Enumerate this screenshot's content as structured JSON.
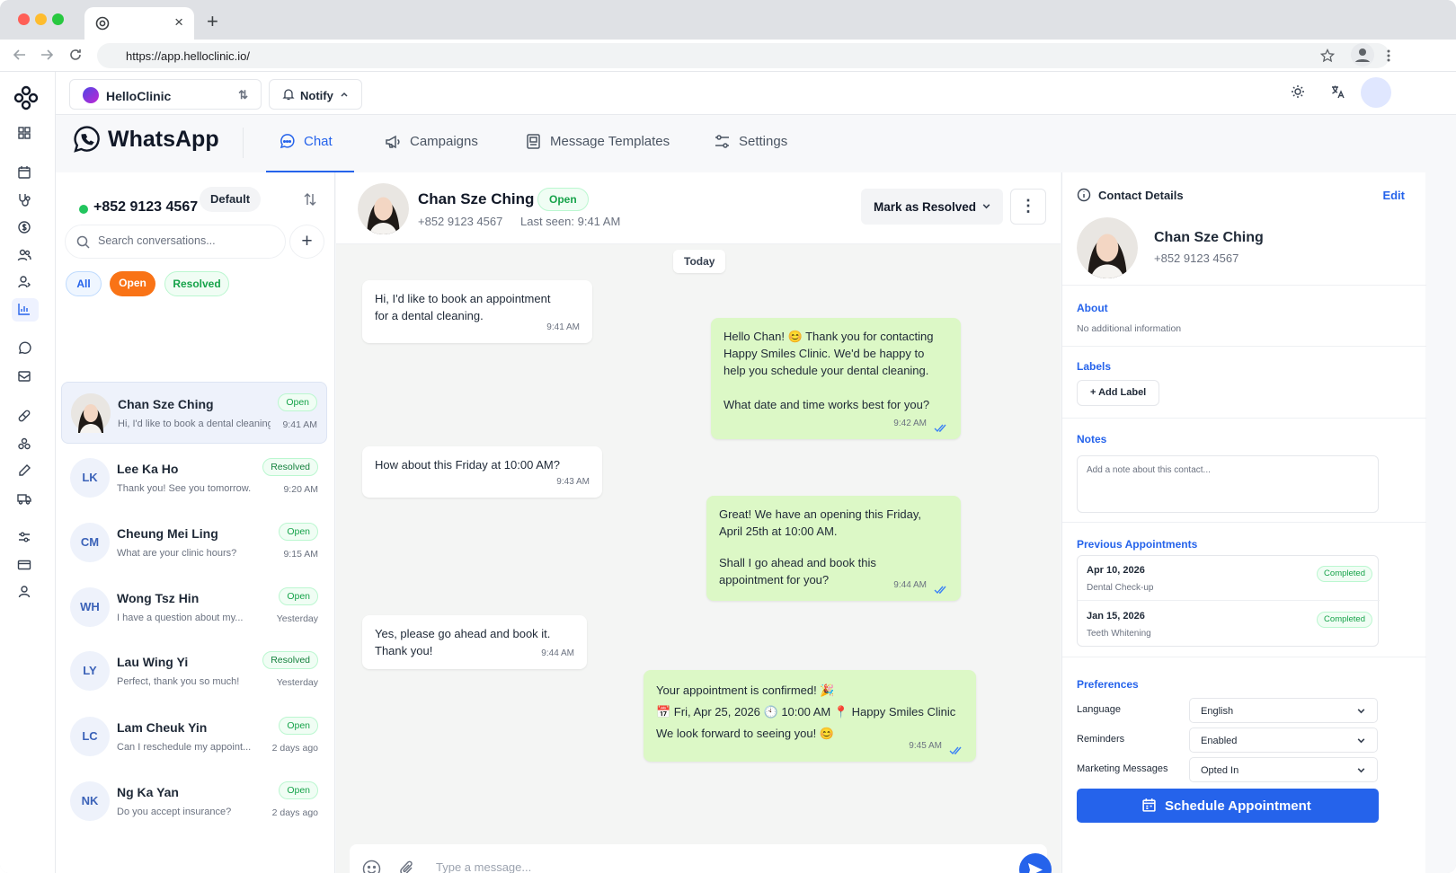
{
  "browser": {
    "url": "https://app.helloclinic.io/",
    "tab_title": ""
  },
  "topbar": {
    "org_name": "HelloClinic",
    "notify_label": "Notify"
  },
  "whatsapp": {
    "title": "WhatsApp",
    "tabs": [
      {
        "label": "Chat",
        "icon": "chat-bubble-icon",
        "active": true
      },
      {
        "label": "Campaigns",
        "icon": "megaphone-icon",
        "active": false
      },
      {
        "label": "Message Templates",
        "icon": "template-icon",
        "active": false
      },
      {
        "label": "Settings",
        "icon": "sliders-icon",
        "active": false
      }
    ]
  },
  "conversations": {
    "phone": "+852 9123 4567",
    "default_label": "Default",
    "search_placeholder": "Search conversations...",
    "filters": {
      "all": "All",
      "open": "Open",
      "resolved": "Resolved"
    },
    "items": [
      {
        "initials": "",
        "name": "Chan Sze Ching",
        "preview": "Hi, I'd like to book a dental cleaning.",
        "status": "Open",
        "time": "9:41 AM",
        "selected": true
      },
      {
        "initials": "LK",
        "name": "Lee Ka Ho",
        "preview": "Thank you! See you tomorrow.",
        "status": "Resolved",
        "time": "9:20 AM"
      },
      {
        "initials": "CM",
        "name": "Cheung Mei Ling",
        "preview": "What are your clinic hours?",
        "status": "Open",
        "time": "9:15 AM"
      },
      {
        "initials": "WH",
        "name": "Wong Tsz Hin",
        "preview": "I have a question about my...",
        "status": "Open",
        "time": "Yesterday"
      },
      {
        "initials": "LY",
        "name": "Lau Wing Yi",
        "preview": "Perfect, thank you so much!",
        "status": "Resolved",
        "time": "Yesterday"
      },
      {
        "initials": "LC",
        "name": "Lam Cheuk Yin",
        "preview": "Can I reschedule my appoint...",
        "status": "Open",
        "time": "2 days ago"
      },
      {
        "initials": "NK",
        "name": "Ng Ka Yan",
        "preview": "Do you accept insurance?",
        "status": "Open",
        "time": "2 days ago"
      }
    ]
  },
  "chat": {
    "contact_name": "Chan Sze Ching",
    "status": "Open",
    "phone": "+852 9123 4567",
    "last_seen": "Last seen: 9:41 AM",
    "resolve_label": "Mark as Resolved",
    "day_separator": "Today",
    "composer_placeholder": "Type a message...",
    "messages": [
      {
        "dir": "in",
        "lines": [
          "Hi, I'd like to book an appointment",
          "for a dental cleaning."
        ],
        "time": "9:41 AM"
      },
      {
        "dir": "out",
        "lines": [
          "Hello Chan! 😊 Thank you for contacting",
          "Happy Smiles Clinic. We'd be happy to",
          "help you schedule your dental cleaning.",
          "",
          "What date and time works best for you?"
        ],
        "time": "9:42 AM"
      },
      {
        "dir": "in",
        "lines": [
          "How about this Friday at 10:00 AM?"
        ],
        "time": "9:43 AM"
      },
      {
        "dir": "out",
        "lines": [
          "Great! We have an opening this Friday,",
          "April 25th at 10:00 AM.",
          "",
          "Shall I go ahead and book this",
          "appointment for you?"
        ],
        "time": "9:44 AM"
      },
      {
        "dir": "in",
        "lines": [
          "Yes, please go ahead and book it.",
          "Thank you!"
        ],
        "time": "9:44 AM"
      },
      {
        "dir": "out",
        "lines": [
          "Your appointment is confirmed! 🎉",
          "📅 Fri, Apr 25, 2026   🕙 10:00 AM   📍 Happy Smiles Clinic",
          "We look forward to seeing you! 😊"
        ],
        "time": "9:45 AM"
      }
    ]
  },
  "details": {
    "header": "Contact Details",
    "edit_label": "Edit",
    "name": "Chan Sze Ching",
    "phone": "+852 9123 4567",
    "about_title": "About",
    "about_text": "No additional information",
    "labels_title": "Labels",
    "add_label": "+ Add Label",
    "notes_title": "Notes",
    "notes_placeholder": "Add a note about this contact...",
    "appointments_title": "Previous Appointments",
    "appointments": [
      {
        "date": "Apr 10, 2026",
        "type": "Dental Check-up",
        "status": "Completed"
      },
      {
        "date": "Jan 15, 2026",
        "type": "Teeth Whitening",
        "status": "Completed"
      }
    ],
    "preferences_title": "Preferences",
    "preferences": [
      {
        "label": "Language",
        "value": "English"
      },
      {
        "label": "Reminders",
        "value": "Enabled"
      },
      {
        "label": "Marketing Messages",
        "value": "Opted In"
      }
    ],
    "schedule_label": "Schedule Appointment"
  },
  "colors": {
    "accent": "#2563eb",
    "open_badge": "#f97316",
    "out_bubble": "#dcf8c6"
  }
}
